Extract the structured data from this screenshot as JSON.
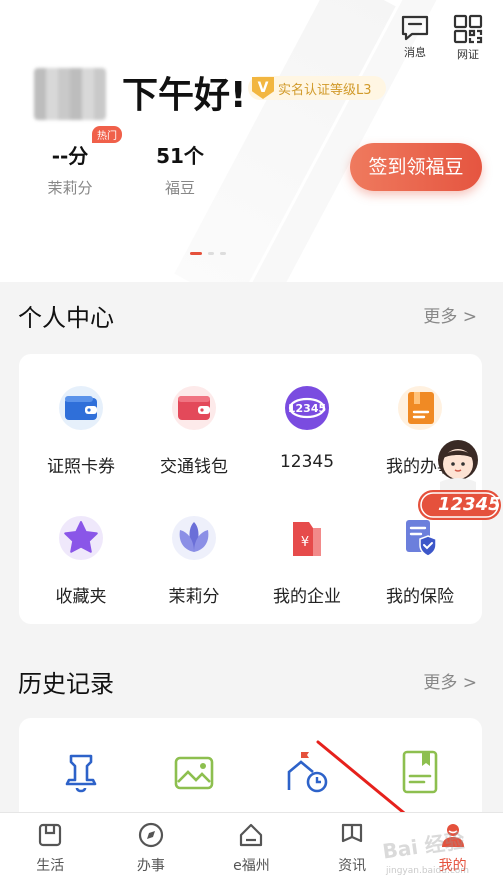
{
  "top_icons": {
    "message": "消息",
    "scan": "网证"
  },
  "user": {
    "greeting": "下午好!",
    "cert_level": "实名认证等级L3",
    "cert_letter": "V"
  },
  "stats": [
    {
      "value": "--分",
      "caption": "茉莉分",
      "tag": "热门"
    },
    {
      "value": "51个",
      "caption": "福豆"
    }
  ],
  "checkin_label": "签到领福豆",
  "personal": {
    "title": "个人中心",
    "more": "更多 >",
    "items": [
      {
        "label": "证照卡券",
        "icon": "wallet-icon"
      },
      {
        "label": "交通钱包",
        "icon": "transit-wallet-icon"
      },
      {
        "label": "12345",
        "icon": "hotline-12345-icon",
        "icon_text": "12345"
      },
      {
        "label": "我的办事",
        "icon": "my-affairs-icon"
      },
      {
        "label": "收藏夹",
        "icon": "star-icon"
      },
      {
        "label": "茉莉分",
        "icon": "jasmine-icon"
      },
      {
        "label": "我的企业",
        "icon": "enterprise-icon",
        "icon_text": "¥"
      },
      {
        "label": "我的保险",
        "icon": "insurance-icon"
      }
    ]
  },
  "history": {
    "title": "历史记录",
    "more": "更多 >",
    "items": [
      {
        "icon": "bell-icon"
      },
      {
        "icon": "landscape-icon"
      },
      {
        "icon": "building-clock-icon"
      },
      {
        "icon": "document-icon"
      }
    ]
  },
  "assistant_badge": "12345",
  "tabs": [
    {
      "label": "生活",
      "icon": "life-icon"
    },
    {
      "label": "办事",
      "icon": "compass-icon"
    },
    {
      "label": "e福州",
      "icon": "home-icon"
    },
    {
      "label": "资讯",
      "icon": "news-icon"
    },
    {
      "label": "我的",
      "icon": "profile-icon",
      "active": true
    }
  ],
  "watermark": {
    "main": "Bai 经验",
    "sub": "jingyan.baidu.com"
  },
  "colors": {
    "accent": "#e5513c",
    "gold": "#f2b640"
  }
}
